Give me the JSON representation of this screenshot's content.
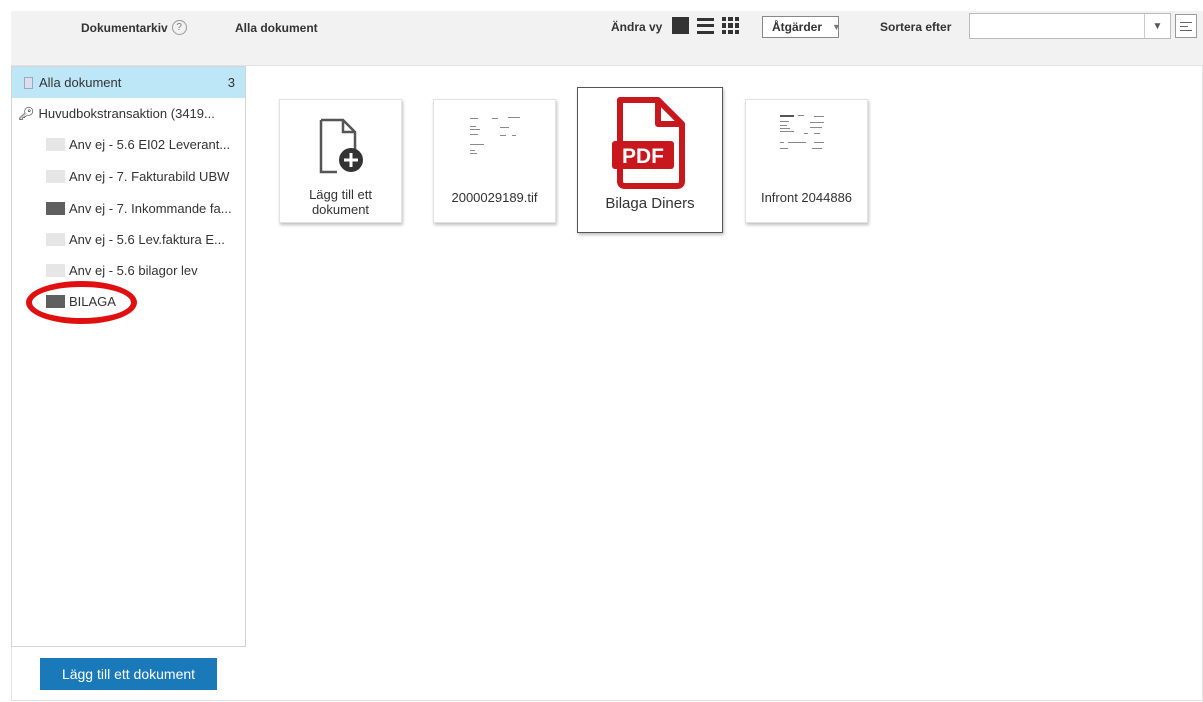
{
  "header": {
    "title": "Dokumentarkiv",
    "help_icon": "?",
    "subtitle": "Alla dokument",
    "view_label": "Ändra vy",
    "actions_label": "Åtgärder",
    "sort_label": "Sortera efter",
    "sort_value": ""
  },
  "sidebar": {
    "items": [
      {
        "label": "Alla dokument",
        "count": "3",
        "icon": "document-icon"
      },
      {
        "label": "Huvudbokstransaktion (3419...",
        "icon": "key-icon"
      },
      {
        "label": "Anv ej - 5.6 EI02 Leverant...",
        "icon": "folder-icon"
      },
      {
        "label": "Anv ej - 7. Fakturabild UBW",
        "icon": "folder-icon"
      },
      {
        "label": "Anv ej - 7. Inkommande fa...",
        "icon": "folder-icon"
      },
      {
        "label": "Anv ej - 5.6 Lev.faktura E...",
        "icon": "folder-icon"
      },
      {
        "label": "Anv ej - 5.6 bilagor lev",
        "icon": "folder-icon"
      },
      {
        "label": "BILAGA",
        "icon": "folder-icon"
      }
    ],
    "highlight_color": "#e01010"
  },
  "documents": [
    {
      "label": "Lägg till ett dokument",
      "icon": "add-document-icon"
    },
    {
      "label": "2000029189.tif",
      "icon": "tif-thumbnail"
    },
    {
      "label": "Bilaga Diners",
      "icon": "pdf-icon",
      "badge": "PDF"
    },
    {
      "label": "Infront 2044886",
      "icon": "document-thumbnail"
    }
  ],
  "footer": {
    "add_button": "Lägg till ett dokument"
  },
  "colors": {
    "accent": "#1a7ab9",
    "active_row": "#bde7f7",
    "pdf_red": "#c8171d"
  }
}
